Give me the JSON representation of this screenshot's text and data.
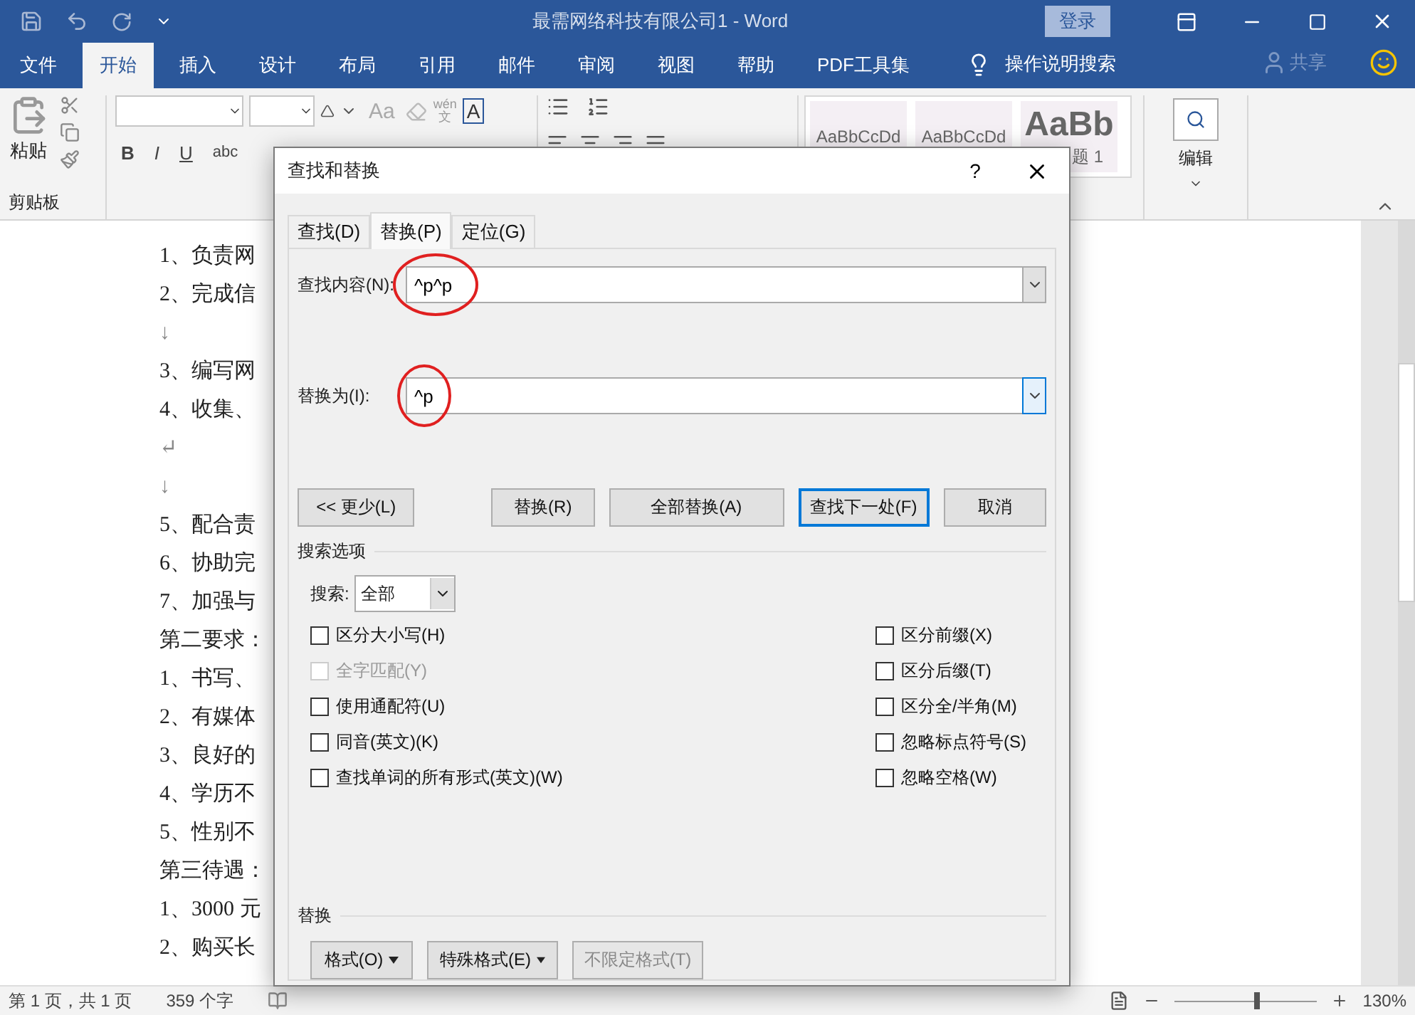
{
  "title_bar": {
    "title": "最需网络科技有限公司1  -  Word",
    "login": "登录"
  },
  "ribbon_tabs": [
    {
      "label": "文件",
      "selected": false
    },
    {
      "label": "开始",
      "selected": true
    },
    {
      "label": "插入",
      "selected": false
    },
    {
      "label": "设计",
      "selected": false
    },
    {
      "label": "布局",
      "selected": false
    },
    {
      "label": "引用",
      "selected": false
    },
    {
      "label": "邮件",
      "selected": false
    },
    {
      "label": "审阅",
      "selected": false
    },
    {
      "label": "视图",
      "selected": false
    },
    {
      "label": "帮助",
      "selected": false
    },
    {
      "label": "PDF工具集",
      "selected": false
    }
  ],
  "tell_me": "操作说明搜索",
  "share": "共享",
  "ribbon": {
    "paste": "粘贴",
    "clipboard_label": "剪贴板",
    "change_case": "Aa",
    "phonetic_top": "wén",
    "phonetic_bottom": "文",
    "char_border": "A",
    "format_buttons": [
      "B",
      "I",
      "U",
      "abc"
    ],
    "styles": [
      {
        "sample": "AaBbCcDd",
        "heading": false
      },
      {
        "sample": "AaBbCcDd",
        "heading": false
      },
      {
        "sample": "AaBb",
        "name": "题 1",
        "heading": true
      }
    ],
    "editing": "编辑"
  },
  "document": {
    "lines": [
      "1、负责网",
      "2、完成信",
      "↓",
      "3、编写网",
      "4、收集、",
      "↵",
      "↓",
      "5、配合责",
      "6、协助完",
      "7、加强与",
      "第二要求：",
      "1、书写、",
      "2、有媒体",
      "3、良好的",
      "4、学历不",
      "5、性别不",
      "第三待遇：",
      "1、3000 元",
      "2、购买长"
    ]
  },
  "dialog": {
    "title": "查找和替换",
    "help": "?",
    "tabs": [
      {
        "label": "查找(D)",
        "selected": false
      },
      {
        "label": "替换(P)",
        "selected": true
      },
      {
        "label": "定位(G)",
        "selected": false
      }
    ],
    "fields": [
      {
        "label": "查找内容(N):",
        "value": "^p^p",
        "focused": false,
        "circled": true
      },
      {
        "label": "替换为(I):",
        "value": "^p",
        "focused": true,
        "circled": true
      }
    ],
    "buttons": [
      {
        "label": "<< 更少(L)",
        "default": false
      },
      {
        "label": "替换(R)",
        "default": false
      },
      {
        "label": "全部替换(A)",
        "default": false
      },
      {
        "label": "查找下一处(F)",
        "default": true
      },
      {
        "label": "取消",
        "default": false
      }
    ],
    "search_options_title": "搜索选项",
    "search_label": "搜索:",
    "search_value": "全部",
    "options_left": [
      {
        "label": "区分大小写(H)",
        "checked": false,
        "disabled": false
      },
      {
        "label": "全字匹配(Y)",
        "checked": false,
        "disabled": true
      },
      {
        "label": "使用通配符(U)",
        "checked": false,
        "disabled": false
      },
      {
        "label": "同音(英文)(K)",
        "checked": false,
        "disabled": false
      },
      {
        "label": "查找单词的所有形式(英文)(W)",
        "checked": false,
        "disabled": false
      }
    ],
    "options_right": [
      {
        "label": "区分前缀(X)",
        "checked": false,
        "disabled": false
      },
      {
        "label": "区分后缀(T)",
        "checked": false,
        "disabled": false
      },
      {
        "label": "区分全/半角(M)",
        "checked": false,
        "disabled": false
      },
      {
        "label": "忽略标点符号(S)",
        "checked": false,
        "disabled": false
      },
      {
        "label": "忽略空格(W)",
        "checked": false,
        "disabled": false
      }
    ],
    "replace_title": "替换",
    "format_buttons": [
      {
        "label": "格式(O)",
        "dropdown": true,
        "disabled": false
      },
      {
        "label": "特殊格式(E)",
        "dropdown": true,
        "disabled": false
      },
      {
        "label": "不限定格式(T)",
        "dropdown": false,
        "disabled": true
      }
    ]
  },
  "status_bar": {
    "page": "第 1 页，共 1 页",
    "words": "359 个字",
    "zoom": "130%",
    "zoom_level": {
      "level": 0.58
    }
  }
}
